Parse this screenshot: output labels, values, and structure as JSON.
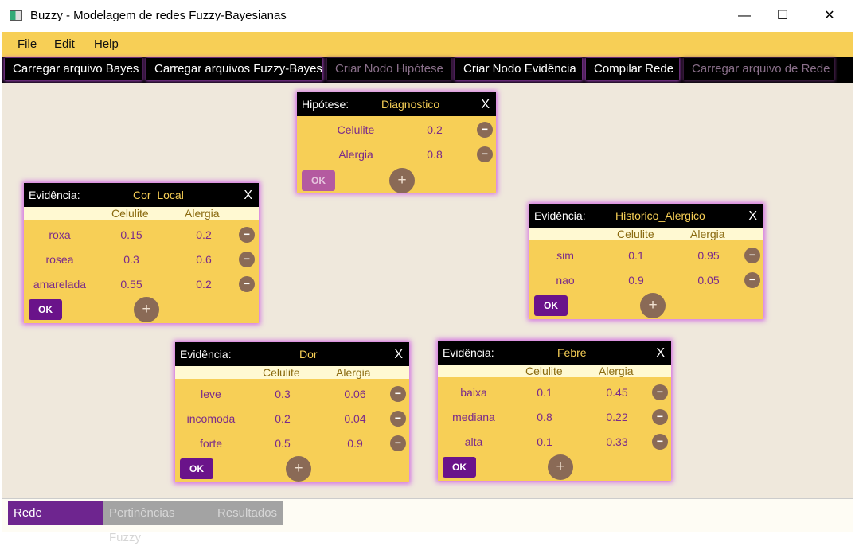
{
  "window": {
    "title": "Buzzy - Modelagem de redes Fuzzy-Bayesianas",
    "minimize": "—",
    "maximize": "☐",
    "close": "✕"
  },
  "menu": [
    "File",
    "Edit",
    "Help"
  ],
  "toolbar": {
    "buttons": [
      {
        "label": "Carregar arquivo Bayes",
        "enabled": true
      },
      {
        "label": "Carregar arquivos Fuzzy-Bayes",
        "enabled": true
      },
      {
        "label": "Criar Nodo Hipótese",
        "enabled": false
      },
      {
        "label": "Criar Nodo Evidência",
        "enabled": true
      },
      {
        "label": "Compilar Rede",
        "enabled": true
      },
      {
        "label": "Carregar arquivo de Rede",
        "enabled": false
      }
    ]
  },
  "nodes": {
    "hypothesis": {
      "kind": "Hipótese:",
      "name": "Diagnostico",
      "close": "X",
      "states": [
        {
          "label": "Celulite",
          "value": "0.2"
        },
        {
          "label": "Alergia",
          "value": "0.8"
        }
      ],
      "ok": "OK",
      "plus": "+",
      "minus": "−"
    },
    "cor_local": {
      "kind": "Evidência:",
      "name": "Cor_Local",
      "close": "X",
      "columns": [
        "Celulite",
        "Alergia"
      ],
      "rows": [
        {
          "label": "roxa",
          "v1": "0.15",
          "v2": "0.2"
        },
        {
          "label": "rosea",
          "v1": "0.3",
          "v2": "0.6"
        },
        {
          "label": "amarelada",
          "v1": "0.55",
          "v2": "0.2"
        }
      ],
      "ok": "OK",
      "plus": "+",
      "minus": "−"
    },
    "historico": {
      "kind": "Evidência:",
      "name": "Historico_Alergico",
      "close": "X",
      "columns": [
        "Celulite",
        "Alergia"
      ],
      "rows": [
        {
          "label": "sim",
          "v1": "0.1",
          "v2": "0.95"
        },
        {
          "label": "nao",
          "v1": "0.9",
          "v2": "0.05"
        }
      ],
      "ok": "OK",
      "plus": "+",
      "minus": "−"
    },
    "dor": {
      "kind": "Evidência:",
      "name": "Dor",
      "close": "X",
      "columns": [
        "Celulite",
        "Alergia"
      ],
      "rows": [
        {
          "label": "leve",
          "v1": "0.3",
          "v2": "0.06"
        },
        {
          "label": "incomoda",
          "v1": "0.2",
          "v2": "0.04"
        },
        {
          "label": "forte",
          "v1": "0.5",
          "v2": "0.9"
        }
      ],
      "ok": "OK",
      "plus": "+",
      "minus": "−"
    },
    "febre": {
      "kind": "Evidência:",
      "name": "Febre",
      "close": "X",
      "columns": [
        "Celulite",
        "Alergia"
      ],
      "rows": [
        {
          "label": "baixa",
          "v1": "0.1",
          "v2": "0.45"
        },
        {
          "label": "mediana",
          "v1": "0.8",
          "v2": "0.22"
        },
        {
          "label": "alta",
          "v1": "0.1",
          "v2": "0.33"
        }
      ],
      "ok": "OK",
      "plus": "+",
      "minus": "−"
    }
  },
  "tabs": [
    {
      "label": "Rede Bayesiana",
      "active": true
    },
    {
      "label": "Pertinências Fuzzy",
      "active": false
    },
    {
      "label": "Resultados",
      "active": false
    }
  ],
  "colors": {
    "accent": "#f7cf56",
    "dark": "#000000",
    "purple": "#6e258f",
    "canvas": "#efe8dc"
  }
}
